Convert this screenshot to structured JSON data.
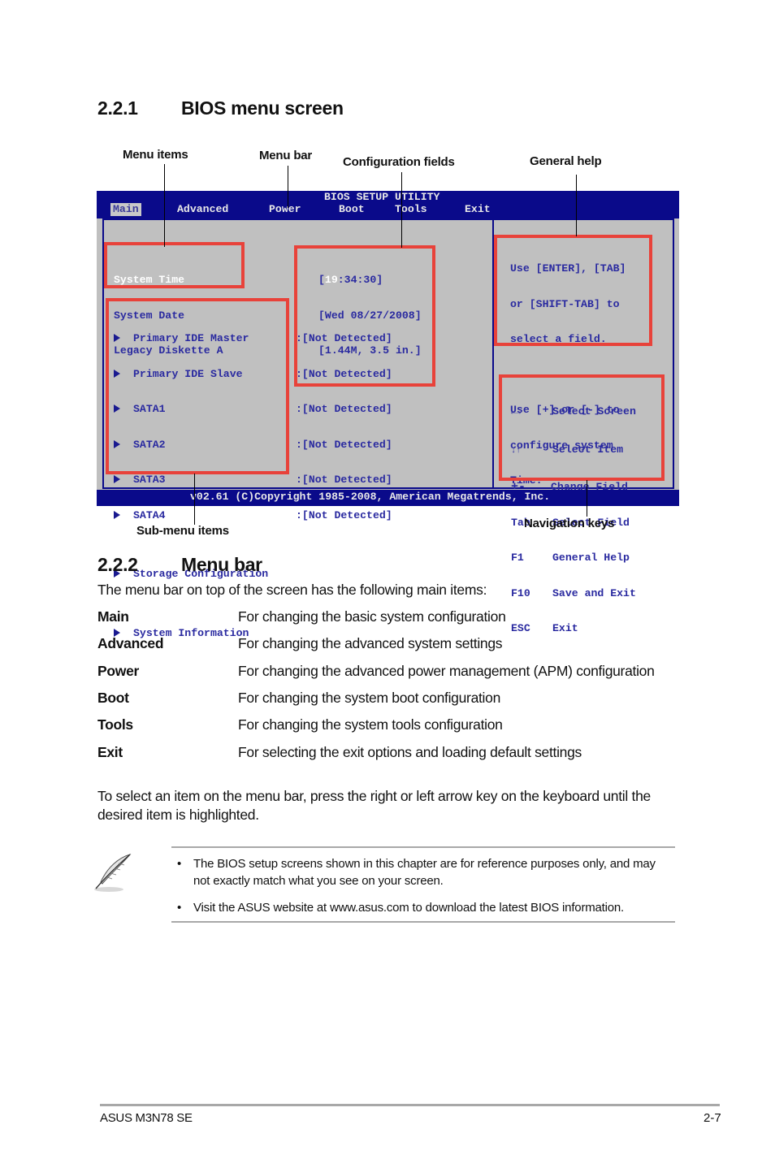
{
  "section1": {
    "number": "2.2.1",
    "title": "BIOS menu screen"
  },
  "callouts": {
    "menu_items": "Menu items",
    "menu_bar": "Menu bar",
    "configuration_fields": "Configuration fields",
    "general_help": "General help",
    "sub_menu_items": "Sub-menu items",
    "navigation_keys": "Navigation keys"
  },
  "bios": {
    "title": "BIOS SETUP UTILITY",
    "tabs": [
      {
        "label": "Main",
        "active": true
      },
      {
        "label": "Advanced"
      },
      {
        "label": "Power"
      },
      {
        "label": "Boot"
      },
      {
        "label": "Tools"
      },
      {
        "label": "Exit"
      }
    ],
    "menu_items": [
      "System Time",
      "System Date",
      "Legacy Diskette A"
    ],
    "config_values": {
      "time_highlight": "19",
      "time_rest": ":34:30]",
      "time_open": "[",
      "date": "[Wed 08/27/2008]",
      "diskette": "[1.44M, 3.5 in.]"
    },
    "sub_menu_items": [
      {
        "label": "Primary IDE Master",
        "value": ":[Not Detected]"
      },
      {
        "label": "Primary IDE Slave",
        "value": ":[Not Detected]"
      },
      {
        "label": "SATA1",
        "value": ":[Not Detected]"
      },
      {
        "label": "SATA2",
        "value": ":[Not Detected]"
      },
      {
        "label": "SATA3",
        "value": ":[Not Detected]"
      },
      {
        "label": "SATA4",
        "value": ":[Not Detected]"
      },
      {
        "label": "Storage Configuration"
      },
      {
        "label": "System Information"
      }
    ],
    "general_help": [
      "Use [ENTER], [TAB]",
      "or [SHIFT-TAB] to",
      "select a field.",
      "",
      "Use [+] or [-] to",
      "configure system",
      "Time."
    ],
    "nav_keys": [
      {
        "key": "←→",
        "action": "Select Screen"
      },
      {
        "key": "↓↑",
        "action": "Select Item"
      },
      {
        "key": "+-",
        "action": "Change Field"
      },
      {
        "key": "Tab",
        "action": "Select Field"
      },
      {
        "key": "F1",
        "action": "General Help"
      },
      {
        "key": "F10",
        "action": "Save and Exit"
      },
      {
        "key": "ESC",
        "action": "Exit"
      }
    ],
    "footer": "v02.61 (C)Copyright 1985-2008, American Megatrends, Inc.",
    "colors": {
      "frame": "#0a0a8a",
      "background": "#c0c0c0",
      "text": "#2a2aa0",
      "callout_box": "#e8423a"
    }
  },
  "section2": {
    "number": "2.2.2",
    "title": "Menu bar",
    "intro": "The menu bar on top of the screen has the following main items:",
    "items": [
      {
        "term": "Main",
        "desc": "For changing the basic system configuration"
      },
      {
        "term": "Advanced",
        "desc": "For changing the advanced system settings"
      },
      {
        "term": "Power",
        "desc": "For changing the advanced power management (APM) configuration"
      },
      {
        "term": "Boot",
        "desc": "For changing the system boot configuration"
      },
      {
        "term": "Tools",
        "desc": "For changing the system tools configuration"
      },
      {
        "term": "Exit",
        "desc": "For selecting the exit options and loading default settings"
      }
    ],
    "outro_line1": "To select an item on the menu bar, press the right or left arrow key on the keyboard until the",
    "outro_line2": "desired item is highlighted."
  },
  "note": {
    "icon": "feather-pen-icon",
    "bullets": [
      {
        "line1": "The BIOS setup screens shown in this chapter are for reference purposes only, and may",
        "line2": "not exactly match what you see on your screen."
      },
      {
        "line1": "Visit the ASUS website at www.asus.com to download the latest BIOS information."
      }
    ]
  },
  "footer": {
    "product": "ASUS M3N78 SE",
    "page": "2-7"
  }
}
